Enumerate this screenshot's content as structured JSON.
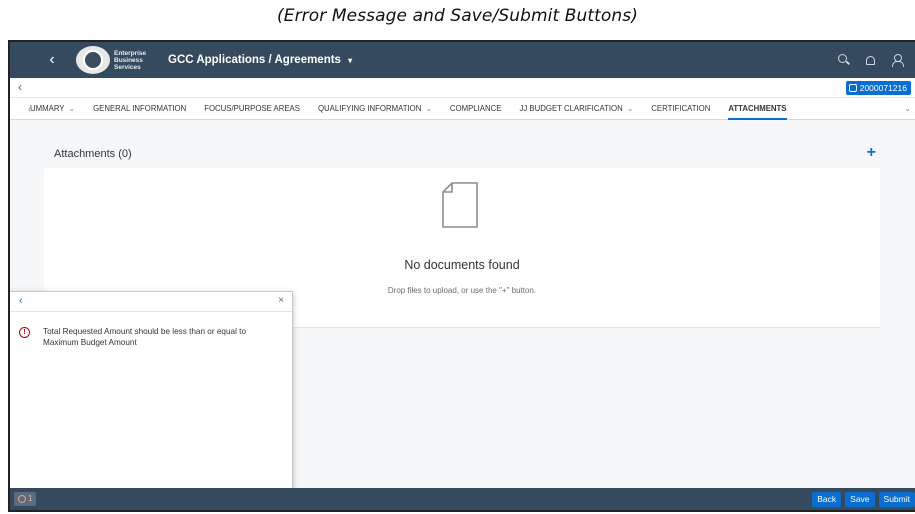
{
  "caption": "(Error Message and Save/Submit Buttons)",
  "shell": {
    "back_glyph": "‹",
    "logo_text": "Enterprise Business Services",
    "title": "GCC Applications / Agreements",
    "title_caret": "▾",
    "icons": [
      "search-icon",
      "bell-icon",
      "user-icon"
    ]
  },
  "subheader": {
    "back_glyph": "‹",
    "record_id": "2000071216"
  },
  "tabs": {
    "items": [
      {
        "label": "UMMARY",
        "has_menu": true
      },
      {
        "label": "GENERAL INFORMATION",
        "has_menu": false
      },
      {
        "label": "FOCUS/PURPOSE AREAS",
        "has_menu": false
      },
      {
        "label": "QUALIFYING INFORMATION",
        "has_menu": true
      },
      {
        "label": "COMPLIANCE",
        "has_menu": false
      },
      {
        "label": "JJ BUDGET CLARIFICATION",
        "has_menu": true
      },
      {
        "label": "CERTIFICATION",
        "has_menu": false
      },
      {
        "label": "ATTACHMENTS",
        "has_menu": false,
        "selected": true
      }
    ],
    "caret": "⌄",
    "prev_glyph": "‹",
    "overflow_glyph": "⌄"
  },
  "attachments": {
    "title": "Attachments (0)",
    "add_glyph": "+",
    "empty_title": "No documents found",
    "empty_hint": "Drop files to upload, or use the \"+\" button."
  },
  "messages": {
    "back_glyph": "‹",
    "close_glyph": "×",
    "error_glyph": "!",
    "items": [
      {
        "type": "error",
        "text": "Total Requested Amount should be less than or equal to Maximum Budget Amount"
      }
    ]
  },
  "footer": {
    "error_count": "1",
    "buttons": {
      "back": "Back",
      "save": "Save",
      "submit": "Submit"
    }
  },
  "colors": {
    "shell": "#354a5f",
    "accent": "#0a6ed1",
    "error": "#bb0000"
  }
}
